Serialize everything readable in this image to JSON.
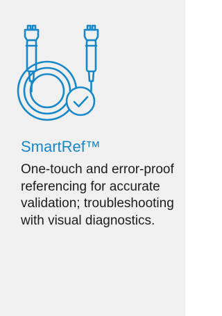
{
  "card": {
    "icon": "fiber-optic-cable-check-icon",
    "title": "SmartRef™",
    "description": "One-touch and error-proof referencing for accurate validation; troubleshooting with visual diagnostics.",
    "colors": {
      "accent": "#1687c9",
      "background": "#f0f0f0",
      "text": "#1c1c1c"
    }
  }
}
